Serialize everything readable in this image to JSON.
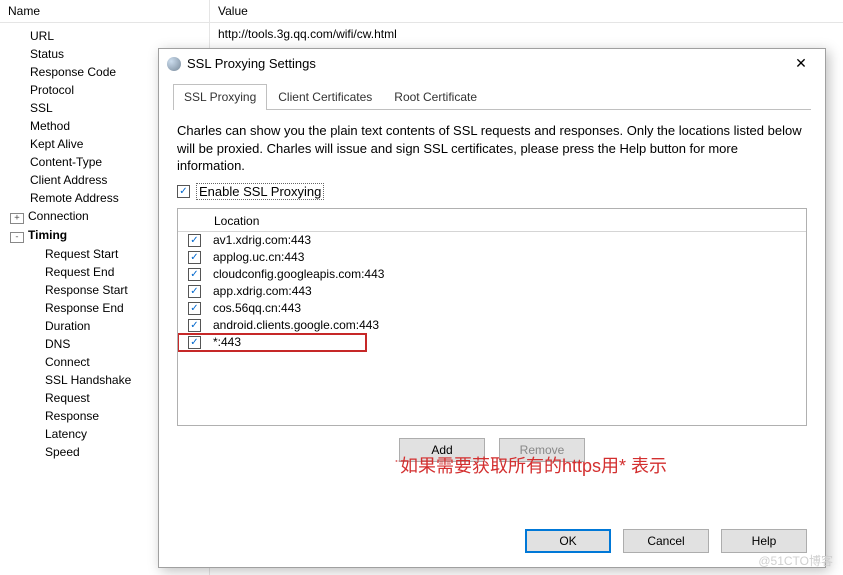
{
  "columns": {
    "name": "Name",
    "value": "Value"
  },
  "tree": {
    "items": [
      {
        "label": "URL",
        "value": "http://tools.3g.qq.com/wifi/cw.html",
        "depth": 1
      },
      {
        "label": "Status",
        "depth": 1
      },
      {
        "label": "Response Code",
        "depth": 1
      },
      {
        "label": "Protocol",
        "depth": 1
      },
      {
        "label": "SSL",
        "depth": 1
      },
      {
        "label": "Method",
        "depth": 1
      },
      {
        "label": "Kept Alive",
        "depth": 1
      },
      {
        "label": "Content-Type",
        "depth": 1
      },
      {
        "label": "Client Address",
        "depth": 1
      },
      {
        "label": "Remote Address",
        "depth": 1
      },
      {
        "label": "Connection",
        "depth": 0,
        "expand": "+"
      },
      {
        "label": "Timing",
        "depth": 0,
        "expand": "-",
        "bold": true
      },
      {
        "label": "Request Start",
        "depth": 2
      },
      {
        "label": "Request End",
        "depth": 2
      },
      {
        "label": "Response Start",
        "depth": 2
      },
      {
        "label": "Response End",
        "depth": 2
      },
      {
        "label": "Duration",
        "depth": 2
      },
      {
        "label": "DNS",
        "depth": 2
      },
      {
        "label": "Connect",
        "depth": 2
      },
      {
        "label": "SSL Handshake",
        "depth": 2
      },
      {
        "label": "Request",
        "depth": 2
      },
      {
        "label": "Response",
        "depth": 2
      },
      {
        "label": "Latency",
        "depth": 2
      },
      {
        "label": "Speed",
        "depth": 2
      }
    ]
  },
  "dialog": {
    "title": "SSL Proxying Settings",
    "tabs": [
      "SSL Proxying",
      "Client Certificates",
      "Root Certificate"
    ],
    "description": "Charles can show you the plain text contents of SSL requests and responses. Only the locations listed below will be proxied. Charles will issue and sign SSL certificates, please press the Help button for more information.",
    "enable_label": "Enable SSL Proxying",
    "list_header": "Location",
    "locations": [
      "av1.xdrig.com:443",
      "applog.uc.cn:443",
      "cloudconfig.googleapis.com:443",
      "app.xdrig.com:443",
      "cos.56qq.cn:443",
      "android.clients.google.com:443",
      "*:443"
    ],
    "buttons": {
      "add": "Add",
      "remove": "Remove",
      "ok": "OK",
      "cancel": "Cancel",
      "help": "Help"
    }
  },
  "annotation": "如果需要获取所有的https用* 表示",
  "watermark": "@51CTO博客"
}
